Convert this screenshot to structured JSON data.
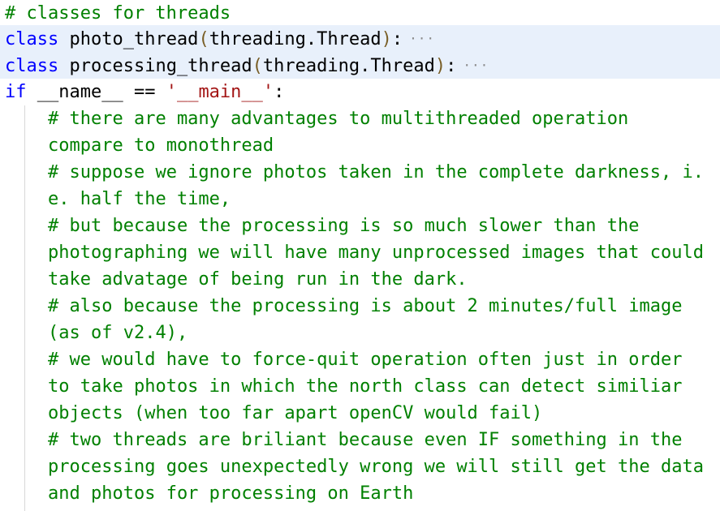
{
  "editor": {
    "lines": [
      {
        "comment": "# classes for threads"
      },
      {
        "keyword": "class",
        "name": "photo_thread",
        "open_paren": "(",
        "base": "threading.Thread",
        "close_paren": ")",
        "colon": ":",
        "fold_marker": "···"
      },
      {
        "keyword": "class",
        "name": "processing_thread",
        "open_paren": "(",
        "base": "threading.Thread",
        "close_paren": ")",
        "colon": ":",
        "fold_marker": "···"
      },
      {
        "keyword": "if",
        "expr": "__name__ ==",
        "string": "'__main__'",
        "colon": ":"
      },
      {
        "comment": "# there are many advantages to multithreaded operation"
      },
      {
        "comment": "compare to monothread"
      },
      {
        "comment": "# suppose we ignore photos taken in the complete darkness, i."
      },
      {
        "comment": "e. half the time,"
      },
      {
        "comment": "# but because the processing is so much slower than the"
      },
      {
        "comment": "photographing we will have many unprocessed images that could"
      },
      {
        "comment": "take advatage of being run in the dark."
      },
      {
        "comment": "# also because the processing is about 2 minutes/full image"
      },
      {
        "comment": "(as of v2.4),"
      },
      {
        "comment": "# we would have to force-quit operation often just in order"
      },
      {
        "comment": "to take photos in which the north class can detect similiar"
      },
      {
        "comment": "objects (when too far apart openCV would fail)"
      },
      {
        "comment": "# two threads are briliant because even IF something in the"
      },
      {
        "comment": "processing goes unexpectedly wrong we will still get the data"
      },
      {
        "comment": "and photos for processing on Earth"
      }
    ]
  }
}
